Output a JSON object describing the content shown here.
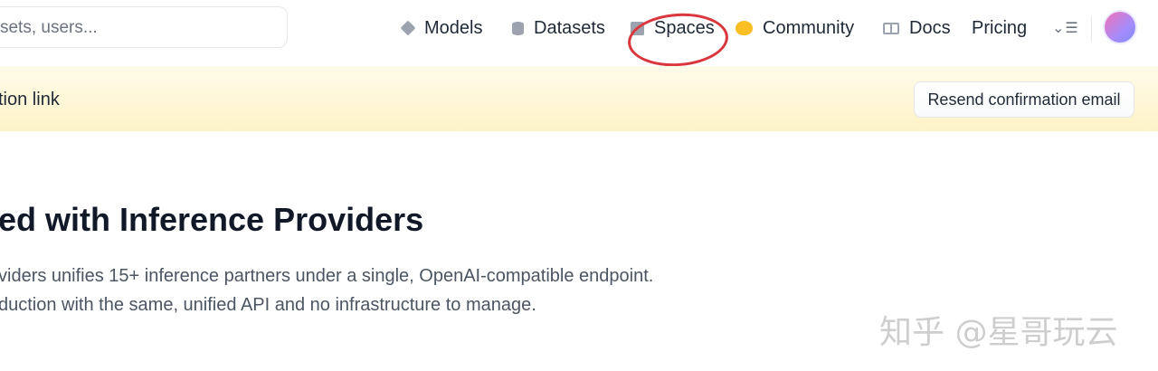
{
  "search": {
    "placeholder": "datasets, users..."
  },
  "nav": {
    "items": [
      {
        "label": "Models",
        "icon": "cube-icon"
      },
      {
        "label": "Datasets",
        "icon": "database-icon"
      },
      {
        "label": "Spaces",
        "icon": "spaces-icon"
      },
      {
        "label": "Community",
        "icon": "hugging-face-icon"
      },
      {
        "label": "Docs",
        "icon": "book-icon"
      },
      {
        "label": "Pricing"
      }
    ],
    "more_menu_glyph": "⌄☰"
  },
  "banner": {
    "text": "tion link",
    "button_label": "Resend confirmation email",
    "background": "#fef3c7"
  },
  "main": {
    "heading": "ed with Inference Providers",
    "paragraph_line1": "viders unifies 15+ inference partners under a single, OpenAI-compatible endpoint.",
    "paragraph_line2": "duction with the same, unified API and no infrastructure to manage."
  },
  "watermark": {
    "text": "知乎 @星哥玩云"
  },
  "colors": {
    "highlight_circle": "#d9363e",
    "avatar_gradient_start": "#f472b6",
    "avatar_gradient_end": "#818cf8"
  }
}
